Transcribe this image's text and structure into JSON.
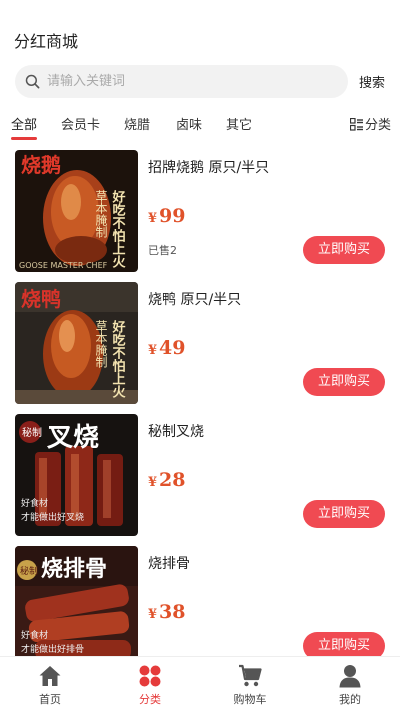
{
  "header": {
    "title": "分红商城"
  },
  "search": {
    "placeholder": "请输入关键词",
    "button_label": "搜索",
    "icon": "search-icon"
  },
  "tabs": [
    {
      "label": "全部",
      "active": true
    },
    {
      "label": "会员卡",
      "active": false
    },
    {
      "label": "烧腊",
      "active": false
    },
    {
      "label": "卤味",
      "active": false
    },
    {
      "label": "其它",
      "active": false
    }
  ],
  "category_toggle": {
    "label": "分类",
    "icon": "grid-list-icon"
  },
  "products": [
    {
      "name": "招牌烧鹅 原只/半只",
      "currency": "¥",
      "price": "99",
      "sold": "已售2",
      "buy_label": "立即购买",
      "image_text": {
        "title": "烧鹅",
        "slogan_1": "好吃不怕上火",
        "slogan_2": "草本腌制",
        "brand": "GOOSE MASTER CHEF"
      }
    },
    {
      "name": "烧鸭 原只/半只",
      "currency": "¥",
      "price": "49",
      "sold": "",
      "buy_label": "立即购买",
      "image_text": {
        "title": "烧鸭",
        "slogan_1": "好吃不怕上火",
        "slogan_2": "草本腌制"
      }
    },
    {
      "name": "秘制叉烧",
      "currency": "¥",
      "price": "28",
      "sold": "",
      "buy_label": "立即购买",
      "image_text": {
        "badge": "秘制",
        "title": "叉烧",
        "caption_1": "好食材",
        "caption_2": "才能做出好叉烧"
      }
    },
    {
      "name": "烧排骨",
      "currency": "¥",
      "price": "38",
      "sold": "",
      "buy_label": "立即购买",
      "image_text": {
        "badge": "秘制",
        "title": "烧排骨",
        "caption_1": "好食材",
        "caption_2": "才能做出好排骨"
      }
    }
  ],
  "tabbar": [
    {
      "label": "首页",
      "icon": "home-icon",
      "active": false
    },
    {
      "label": "分类",
      "icon": "category-icon",
      "active": true
    },
    {
      "label": "购物车",
      "icon": "cart-icon",
      "active": false
    },
    {
      "label": "我的",
      "icon": "user-icon",
      "active": false
    }
  ],
  "colors": {
    "accent": "#e53b3b",
    "buy_button": "#f04a52",
    "price": "#e0522a"
  }
}
